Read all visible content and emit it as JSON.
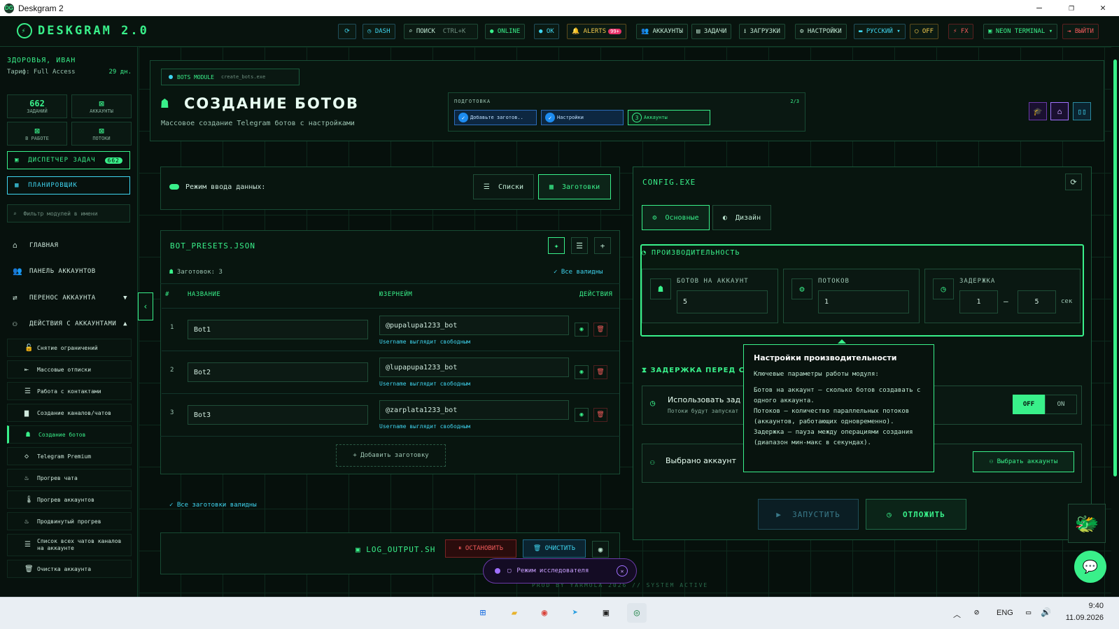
{
  "window": {
    "title": "Deskgram 2",
    "logo": "DG",
    "min": "—",
    "max": "❐",
    "close": "✕"
  },
  "topbar": {
    "brand": "DESKGRAM 2.0",
    "refresh": "⟳",
    "dash": "DASH",
    "search": "ПОИСК",
    "shortcut": "CTRL+K",
    "online": "ONLINE",
    "ok": "OK",
    "alerts": "ALERTS",
    "alerts_count": "99+",
    "accounts": "АККАУНТЫ",
    "tasks": "ЗАДАЧИ",
    "downloads": "ЗАГРУЗКИ",
    "settings": "НАСТРОЙКИ",
    "lang": "РУССКИЙ",
    "off": "OFF",
    "fx": "FX",
    "neon": "NEON TERMINAL",
    "logout": "ВЫЙТИ"
  },
  "sidebar": {
    "user": "ЗДОРОВЬЯ, ИВАН",
    "tariff": "Тариф: Full Access",
    "days": "29 дн.",
    "stats": [
      {
        "value": "662",
        "label": "ЗАДАНИЙ"
      },
      {
        "value": "⊠",
        "label": "АККАУНТЫ"
      },
      {
        "value": "⊠",
        "label": "В РАБОТЕ"
      },
      {
        "value": "⊠",
        "label": "ПОТОКИ"
      }
    ],
    "dispatcher": "ДИСПЕТЧЕР ЗАДАЧ",
    "dispatcher_count": "662",
    "planner": "ПЛАНИРОВЩИК",
    "filter_placeholder": "Фильтр модулей в имени",
    "nav": [
      {
        "label": "ГЛАВНАЯ"
      },
      {
        "label": "ПАНЕЛЬ АККАУНТОВ"
      },
      {
        "label": "ПЕРЕНОС АККАУНТА"
      },
      {
        "label": "ДЕЙСТВИЯ С АККАУНТАМИ"
      }
    ],
    "sub": [
      "Снятие ограничений",
      "Массовые отписки",
      "Работа с контактами",
      "Создание каналов/чатов",
      "Создание ботов",
      "Telegram Premium",
      "Прогрев чата",
      "Прогрев аккаунтов",
      "Продвинутый прогрев",
      "Список всех чатов каналов на аккаунте",
      "Очистка аккаунта"
    ]
  },
  "header": {
    "module_tag": "BOTS MODULE",
    "module_file": "create_bots.exe",
    "title": "СОЗДАНИЕ БОТОВ",
    "subtitle": "Массовое создание Telegram ботов с настройками",
    "prep_label": "ПОДГОТОВКА",
    "prep_progress": "2/3",
    "steps": [
      {
        "label": "Добавьте заготов..",
        "mark": "✓"
      },
      {
        "label": "Настройки",
        "mark": "✓"
      },
      {
        "label": "Аккаунты",
        "mark": "3"
      }
    ]
  },
  "input_mode": {
    "label": "Режим ввода данных:",
    "lists": "Списки",
    "presets": "Заготовки"
  },
  "presets": {
    "title": "BOT_PRESETS.JSON",
    "count_label": "Заготовок: 3",
    "all_valid": "Все валидны",
    "col_num": "#",
    "col_name": "НАЗВАНИЕ",
    "col_user": "ЮЗЕРНЕЙМ",
    "col_actions": "ДЕЙСТВИЯ",
    "rows": [
      {
        "num": "1",
        "name": "Bot1",
        "username": "@pupalupa1233_bot",
        "hint": "Username выглядит свободным"
      },
      {
        "num": "2",
        "name": "Bot2",
        "username": "@lupapupa1233_bot",
        "hint": "Username выглядит свободным"
      },
      {
        "num": "3",
        "name": "Bot3",
        "username": "@zarplata1233_bot",
        "hint": "Username выглядит свободным"
      }
    ],
    "add": "+ Добавить заготовку",
    "footer_valid": "Все заготовки валидны"
  },
  "log": {
    "title": "LOG_OUTPUT.SH",
    "stop": "ОСТАНОВИТЬ",
    "clear": "ОЧИСТИТЬ"
  },
  "explorer": {
    "label": "Режим исследователя"
  },
  "footer": {
    "text": "PROD BY YARMOLA 2026   //  SYSTEM ACTIVE"
  },
  "config": {
    "title": "CONFIG.EXE",
    "tab_main": "Основные",
    "tab_design": "Дизайн",
    "perf_title": "ПРОИЗВОДИТЕЛЬНОСТЬ",
    "bots_label": "БОТОВ НА АККАУНТ",
    "bots_value": "5",
    "threads_label": "ПОТОКОВ",
    "threads_value": "1",
    "delay_label": "ЗАДЕРЖКА",
    "delay_min": "1",
    "delay_max": "5",
    "delay_unit": "сек",
    "delay_before": "ЗАДЕРЖКА ПЕРЕД СТ",
    "use_delay": "Использовать зад",
    "use_delay_sub": "Потоки будут запускат",
    "off": "OFF",
    "on": "ON",
    "selected": "Выбрано аккаунт",
    "choose": "Выбрать аккаунты",
    "start": "ЗАПУСТИТЬ",
    "postpone": "ОТЛОЖИТЬ"
  },
  "tooltip": {
    "title": "Настройки производительности",
    "intro": "Ключевые параметры работы модуля:",
    "p1": "Ботов на аккаунт — сколько ботов создавать с одного аккаунта.",
    "p2": "Потоков — количество параллельных потоков (аккаунтов, работающих одновременно).",
    "p3": "Задержка — пауза между операциями создания (диапазон мин-макс в секундах)."
  },
  "taskbar": {
    "lang": "ENG",
    "time": "9:40",
    "date": "11.09.2026"
  },
  "colors": {
    "accent": "#39f08a",
    "cyan": "#3fd5f0",
    "danger": "#f05a5a"
  }
}
